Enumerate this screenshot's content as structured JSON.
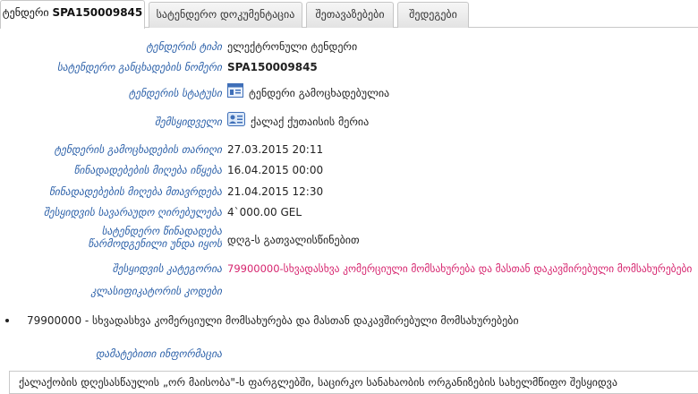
{
  "tabs": [
    {
      "prefix": "ტენდერი",
      "id": "SPA150009845"
    },
    {
      "label": "სატენდერო დოკუმენტაცია"
    },
    {
      "label": "შეთავაზებები"
    },
    {
      "label": "შედეგები"
    }
  ],
  "details": {
    "tender_type": {
      "label": "ტენდერის ტიპი",
      "value": "ელექტრონული ტენდერი"
    },
    "announcement_number": {
      "label": "სატენდერო განცხადების ნომერი",
      "value": "SPA150009845"
    },
    "status": {
      "label": "ტენდერის სტატუსი",
      "value": "ტენდერი გამოცხადებულია",
      "icon": "announcement-icon"
    },
    "buyer": {
      "label": "შემსყიდველი",
      "value": "ქალაქ ქუთაისის მერია",
      "icon": "organization-card-icon"
    },
    "announcement_date": {
      "label": "ტენდერის გამოცხადების თარიღი",
      "value": "27.03.2015 20:11"
    },
    "bids_start": {
      "label": "წინადადებების მიღება იწყება",
      "value": "16.04.2015 00:00"
    },
    "bids_end": {
      "label": "წინადადებების მიღება მთავრდება",
      "value": "21.04.2015 12:30"
    },
    "estimated_value": {
      "label": "შესყიდვის სავარაუდო ღირებულება",
      "value": "4`000.00 GEL"
    },
    "submission_form": {
      "label": "სატენდერო წინადადება წარმოდგენილი უნდა იყოს",
      "value": "დღგ-ს გათვალისწინებით"
    },
    "category": {
      "label": "შესყიდვის კატეგორია",
      "value": "79900000-სხვადასხვა კომერციული მომსახურება და მასთან დაკავშირებული მომსახურებები"
    },
    "classifier_codes": {
      "label": "კლასიფიკატორის კოდები"
    }
  },
  "classifier_list": [
    "79900000 - სხვადასხვა კომერციული მომსახურება და მასთან დაკავშირებული მომსახურებები"
  ],
  "additional_info": {
    "label": "დამატებითი ინფორმაცია",
    "text": "ქალაქობის დღესასწაულის „ორ მაისობა\"-ს ფარგლებში, საცირკო სანახაობის ორგანიზების სახელმწიფო შესყიდვა"
  },
  "colors": {
    "label": "#2a5fa8",
    "category": "#d6246e"
  }
}
